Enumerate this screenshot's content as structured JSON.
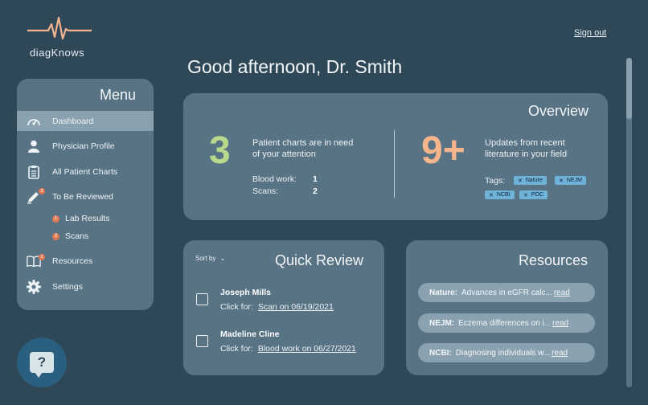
{
  "app": {
    "logo_text": "diagKnows",
    "sign_out": "Sign out"
  },
  "greeting": "Good afternoon, Dr. Smith",
  "menu": {
    "title": "Menu",
    "items": [
      {
        "label": "Dashboard",
        "icon": "speedometer-icon",
        "active": true
      },
      {
        "label": "Physician Profile",
        "icon": "person-icon"
      },
      {
        "label": "All Patient Charts",
        "icon": "clipboard-icon"
      },
      {
        "label": "To Be Reviewed",
        "icon": "pen-icon",
        "badge": "3"
      },
      {
        "label": "Resources",
        "icon": "book-icon",
        "badge": "1"
      },
      {
        "label": "Settings",
        "icon": "gear-icon"
      }
    ],
    "subitems": [
      {
        "label": "Lab Results",
        "badge": "1"
      },
      {
        "label": "Scans",
        "badge": "2"
      }
    ]
  },
  "help": {
    "label": "?"
  },
  "overview": {
    "title": "Overview",
    "charts_count": "3",
    "charts_text": "Patient charts are in need of your attention",
    "blood_work_label": "Blood work:",
    "blood_work_value": "1",
    "scans_label": "Scans:",
    "scans_value": "2",
    "updates_count": "9+",
    "updates_text": "Updates from recent literature in your field",
    "tags_label": "Tags:",
    "tags": [
      "Nature",
      "NEJM",
      "NCBI",
      "POC"
    ],
    "colors": {
      "charts": "#b8d98b",
      "updates": "#f4b48c"
    }
  },
  "quick_review": {
    "title": "Quick Review",
    "sort_label": "Sort by",
    "click_for": "Click for:",
    "items": [
      {
        "name": "Joseph Mills",
        "link": "Scan on 06/19/2021"
      },
      {
        "name": "Madeline Cline",
        "link": "Blood work on 06/27/2021"
      }
    ]
  },
  "resources": {
    "title": "Resources",
    "items": [
      {
        "source": "Nature:",
        "text": "Advances in eGFR calc...",
        "read": "read"
      },
      {
        "source": "NEJM:",
        "text": "Eczema differences on i...",
        "read": "read"
      },
      {
        "source": "NCBI:",
        "text": "Diagnosing individuals w...",
        "read": "read"
      }
    ]
  }
}
